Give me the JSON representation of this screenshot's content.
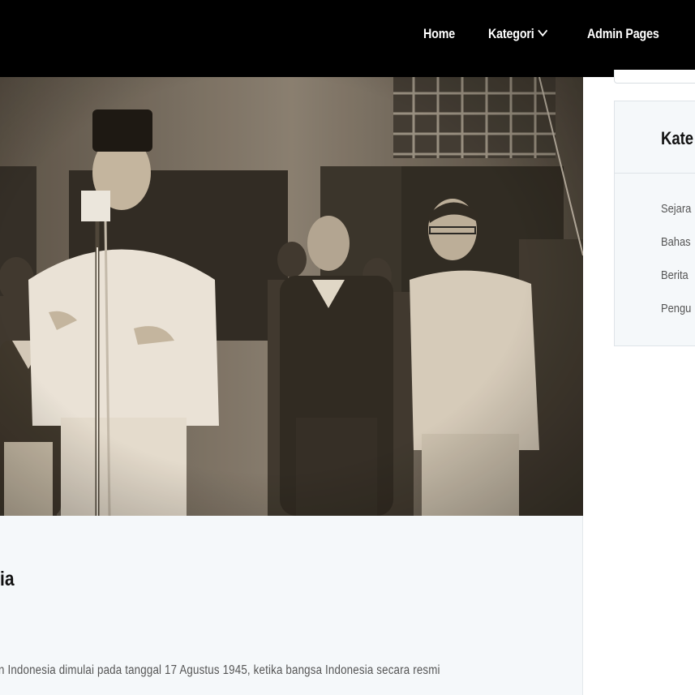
{
  "nav": {
    "items": [
      {
        "label": "Home"
      },
      {
        "label": "Kategori",
        "has_dropdown": true
      },
      {
        "label": "Admin Pages"
      }
    ]
  },
  "post": {
    "title": "ia",
    "excerpt": "n Indonesia dimulai pada tanggal 17 Agustus 1945, ketika bangsa Indonesia secara resmi"
  },
  "sidebar": {
    "widget_title": "Kate",
    "categories": [
      {
        "label": "Sejara"
      },
      {
        "label": "Bahas"
      },
      {
        "label": "Berita"
      },
      {
        "label": "Pengu"
      }
    ]
  },
  "colors": {
    "navbar_bg": "#000000",
    "content_bg": "#f5f8fa",
    "photo_tone": "sepia"
  }
}
